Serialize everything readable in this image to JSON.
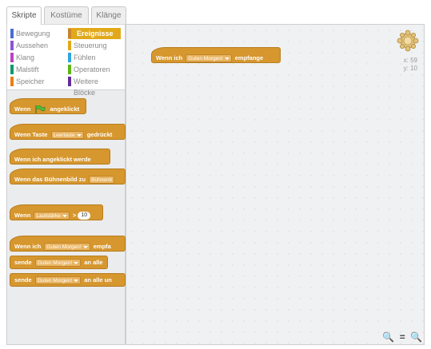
{
  "tabs": [
    "Skripte",
    "Kostüme",
    "Klänge"
  ],
  "categories": [
    {
      "label": "Bewegung",
      "color": "#4a6cd4"
    },
    {
      "label": "Ereignisse",
      "color": "#c88330",
      "selected": true
    },
    {
      "label": "Aussehen",
      "color": "#8a55d7"
    },
    {
      "label": "Steuerung",
      "color": "#e1a91a"
    },
    {
      "label": "Klang",
      "color": "#bb42c3"
    },
    {
      "label": "Fühlen",
      "color": "#2ca5e2"
    },
    {
      "label": "Malstift",
      "color": "#0e9a6c"
    },
    {
      "label": "Operatoren",
      "color": "#5cb712"
    },
    {
      "label": "Speicher",
      "color": "#ee7d16"
    },
    {
      "label": "Weitere Blöcke",
      "color": "#632d99"
    }
  ],
  "blocks": {
    "flag": {
      "pre": "Wenn",
      "post": "angeklickt"
    },
    "key": {
      "pre": "Wenn Taste",
      "field": "Leertaste",
      "post": "gedrückt"
    },
    "sprite": {
      "text": "Wenn ich angeklickt werde"
    },
    "backdrop": {
      "pre": "Wenn das Bühnenbild zu",
      "field": "Bühnenb"
    },
    "sensor": {
      "pre": "Wenn",
      "field": "Lautstärke",
      "op": ">",
      "num": "10"
    },
    "receive": {
      "pre": "Wenn ich",
      "field": "Guten Morgen!",
      "post": "empfa"
    },
    "broadcast": {
      "pre": "sende",
      "field": "Guten Morgen!",
      "post": "an alle"
    },
    "broadcast_wait": {
      "pre": "sende",
      "field": "Guten Morgen!",
      "post": "an alle un"
    }
  },
  "script": {
    "pre": "Wenn ich",
    "field": "Guten Morgen!",
    "post": "empfange"
  },
  "coords": {
    "x": "x: 59",
    "y": "y: 10"
  },
  "zoom": {
    "out": "🔍",
    "reset": "=",
    "in": "🔍"
  }
}
